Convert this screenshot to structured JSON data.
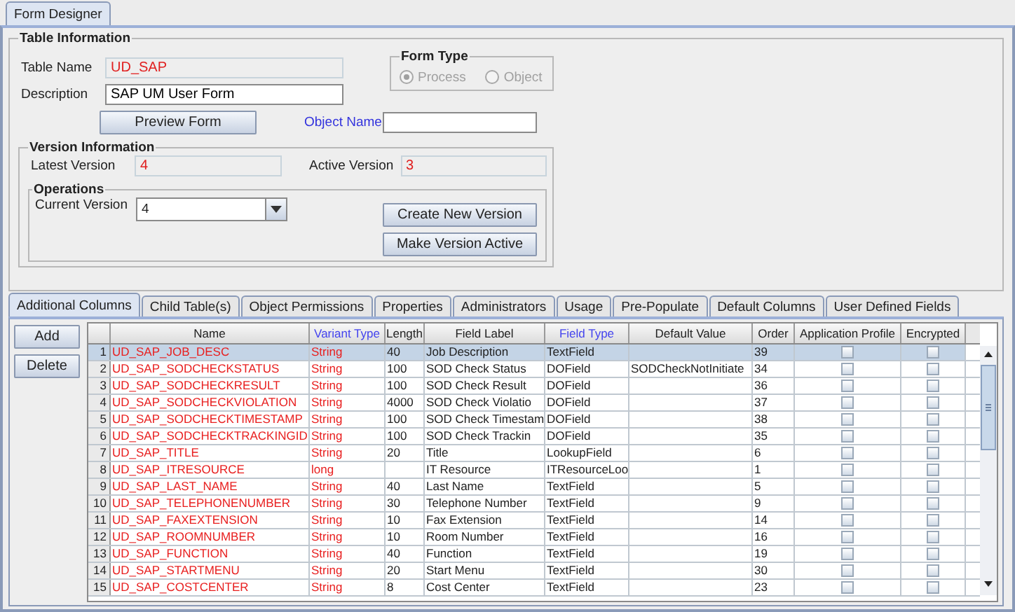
{
  "window_tab": {
    "label": "Form Designer",
    "selected": true
  },
  "table_information": {
    "title": "Table Information",
    "table_name": {
      "label": "Table Name",
      "value": "UD_SAP"
    },
    "description": {
      "label": "Description",
      "value": "SAP UM User Form"
    },
    "preview_button": "Preview Form",
    "form_type": {
      "title": "Form Type",
      "disabled": true,
      "options": [
        {
          "label": "Process",
          "selected": true
        },
        {
          "label": "Object",
          "selected": false
        }
      ]
    },
    "object_name": {
      "label": "Object Name"
    }
  },
  "version_information": {
    "title": "Version Information",
    "latest_version": {
      "label": "Latest Version",
      "value": "4"
    },
    "active_version": {
      "label": "Active Version",
      "value": "3"
    },
    "operations": {
      "title": "Operations",
      "current_version": {
        "label": "Current Version",
        "value": "4"
      },
      "buttons": [
        "Create New Version",
        "Make Version Active"
      ]
    }
  },
  "tabs": [
    {
      "label": "Additional Columns",
      "selected": true
    },
    {
      "label": "Child Table(s)",
      "selected": false
    },
    {
      "label": "Object Permissions",
      "selected": false
    },
    {
      "label": "Properties",
      "selected": false
    },
    {
      "label": "Administrators",
      "selected": false
    },
    {
      "label": "Usage",
      "selected": false
    },
    {
      "label": "Pre-Populate",
      "selected": false
    },
    {
      "label": "Default Columns",
      "selected": false
    },
    {
      "label": "User Defined Fields",
      "selected": false
    }
  ],
  "side_buttons": [
    "Add",
    "Delete"
  ],
  "columns": [
    {
      "label": "Name",
      "highlighted": false,
      "emphasis": true,
      "kind": "text"
    },
    {
      "label": "Variant Type",
      "highlighted": true,
      "emphasis": true,
      "kind": "text"
    },
    {
      "label": "Length",
      "highlighted": false,
      "emphasis": false,
      "kind": "text"
    },
    {
      "label": "Field Label",
      "highlighted": false,
      "emphasis": false,
      "kind": "text"
    },
    {
      "label": "Field Type",
      "highlighted": true,
      "emphasis": false,
      "kind": "text"
    },
    {
      "label": "Default Value",
      "highlighted": false,
      "emphasis": false,
      "kind": "text"
    },
    {
      "label": "Order",
      "highlighted": false,
      "emphasis": false,
      "kind": "text"
    },
    {
      "label": "Application Profile",
      "highlighted": false,
      "kind": "check"
    },
    {
      "label": "Encrypted",
      "highlighted": false,
      "kind": "check"
    }
  ],
  "rows": [
    {
      "num": "1",
      "selected": true,
      "name": "UD_SAP_JOB_DESC",
      "variant_type": "String",
      "length": "40",
      "field_label": "Job Description",
      "field_type": "TextField",
      "order": "39",
      "application_profile": false,
      "encrypted": false
    },
    {
      "num": "2",
      "selected": false,
      "name": "UD_SAP_SODCHECKSTATUS",
      "variant_type": "String",
      "length": "100",
      "field_label": "SOD Check Status",
      "field_type": "DOField",
      "default_value": "SODCheckNotInitiate",
      "order": "34",
      "application_profile": false,
      "encrypted": false
    },
    {
      "num": "3",
      "selected": false,
      "name": "UD_SAP_SODCHECKRESULT",
      "variant_type": "String",
      "length": "100",
      "field_label": "SOD Check Result",
      "field_type": "DOField",
      "order": "36",
      "application_profile": false,
      "encrypted": false
    },
    {
      "num": "4",
      "selected": false,
      "name": "UD_SAP_SODCHECKVIOLATION",
      "variant_type": "String",
      "length": "4000",
      "field_label": "SOD Check Violatio",
      "field_type": "DOField",
      "order": "37",
      "application_profile": false,
      "encrypted": false
    },
    {
      "num": "5",
      "selected": false,
      "name": "UD_SAP_SODCHECKTIMESTAMP",
      "variant_type": "String",
      "length": "100",
      "field_label": "SOD Check Timestam",
      "field_type": "DOField",
      "order": "38",
      "application_profile": false,
      "encrypted": false
    },
    {
      "num": "6",
      "selected": false,
      "name": "UD_SAP_SODCHECKTRACKINGID",
      "variant_type": "String",
      "length": "100",
      "field_label": "SOD Check Trackin",
      "field_type": "DOField",
      "order": "35",
      "application_profile": false,
      "encrypted": false
    },
    {
      "num": "7",
      "selected": false,
      "name": "UD_SAP_TITLE",
      "variant_type": "String",
      "length": "20",
      "field_label": "Title",
      "field_type": "LookupField",
      "order": "6",
      "application_profile": false,
      "encrypted": false
    },
    {
      "num": "8",
      "selected": false,
      "name": "UD_SAP_ITRESOURCE",
      "variant_type": "long",
      "field_label": "IT Resource",
      "field_type": "ITResourceLoo",
      "order": "1",
      "application_profile": false,
      "encrypted": false
    },
    {
      "num": "9",
      "selected": false,
      "name": "UD_SAP_LAST_NAME",
      "variant_type": "String",
      "length": "40",
      "field_label": "Last Name",
      "field_type": "TextField",
      "order": "5",
      "application_profile": false,
      "encrypted": false
    },
    {
      "num": "10",
      "selected": false,
      "name": "UD_SAP_TELEPHONENUMBER",
      "variant_type": "String",
      "length": "30",
      "field_label": "Telephone Number",
      "field_type": "TextField",
      "order": "9",
      "application_profile": false,
      "encrypted": false
    },
    {
      "num": "11",
      "selected": false,
      "name": "UD_SAP_FAXEXTENSION",
      "variant_type": "String",
      "length": "10",
      "field_label": "Fax Extension",
      "field_type": "TextField",
      "order": "14",
      "application_profile": false,
      "encrypted": false
    },
    {
      "num": "12",
      "selected": false,
      "name": "UD_SAP_ROOMNUMBER",
      "variant_type": "String",
      "length": "10",
      "field_label": "Room Number",
      "field_type": "TextField",
      "order": "16",
      "application_profile": false,
      "encrypted": false
    },
    {
      "num": "13",
      "selected": false,
      "name": "UD_SAP_FUNCTION",
      "variant_type": "String",
      "length": "40",
      "field_label": "Function",
      "field_type": "TextField",
      "order": "19",
      "application_profile": false,
      "encrypted": false
    },
    {
      "num": "14",
      "selected": false,
      "name": "UD_SAP_STARTMENU",
      "variant_type": "String",
      "length": "20",
      "field_label": "Start Menu",
      "field_type": "TextField",
      "order": "30",
      "application_profile": false,
      "encrypted": false
    },
    {
      "num": "15",
      "selected": false,
      "name": "UD_SAP_COSTCENTER",
      "variant_type": "String",
      "length": "8",
      "field_label": "Cost Center",
      "field_type": "TextField",
      "order": "23",
      "application_profile": false,
      "encrypted": false
    }
  ]
}
